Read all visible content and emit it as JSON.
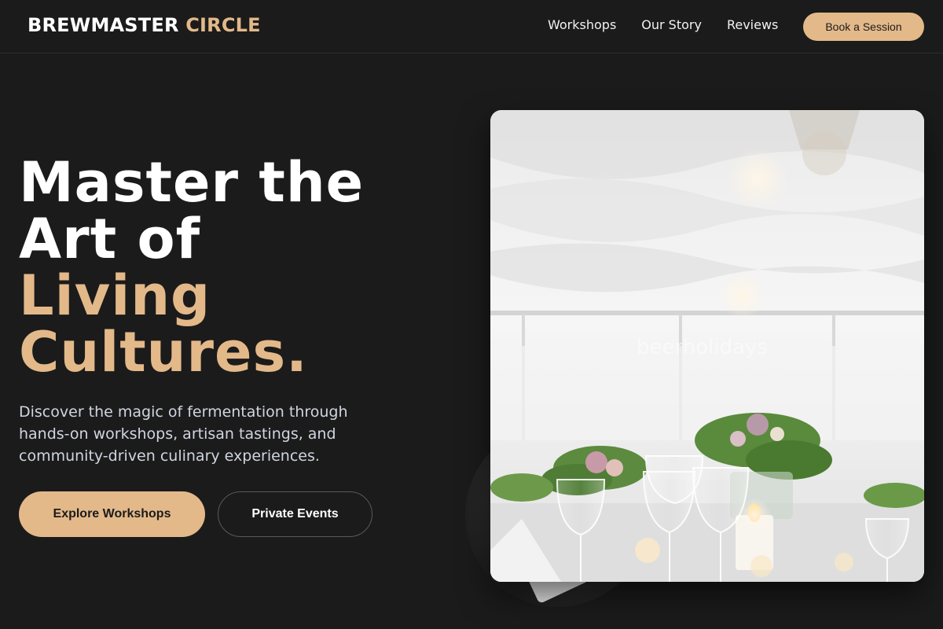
{
  "header": {
    "brand_primary": "BREWMASTER",
    "brand_accent": "CIRCLE",
    "nav": [
      {
        "label": "Workshops"
      },
      {
        "label": "Our Story"
      },
      {
        "label": "Reviews"
      }
    ],
    "cta_label": "Book a Session"
  },
  "hero": {
    "title_line1": "Master the",
    "title_line2": "Art of",
    "title_line3": "Living",
    "title_line4": "Cultures.",
    "description": "Discover the magic of fermentation through hands-on workshops, artisan tastings, and community-driven culinary experiences.",
    "primary_button": "Explore Workshops",
    "secondary_button": "Private Events"
  },
  "image": {
    "watermark": "beerholidays"
  },
  "colors": {
    "background": "#1c1b1b",
    "accent": "#e3b98a",
    "text": "#ffffff",
    "muted_text": "#cfd5e0"
  }
}
